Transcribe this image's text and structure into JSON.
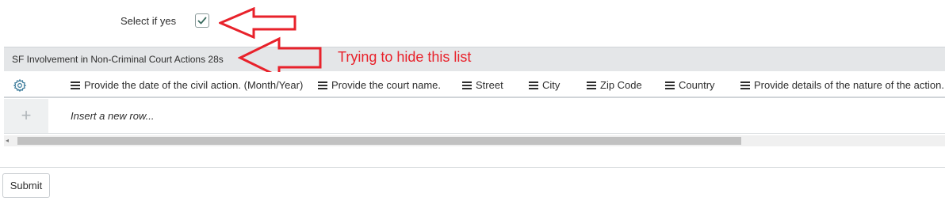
{
  "form": {
    "checkbox_label": "Select if yes",
    "checkbox_checked": true
  },
  "list": {
    "title": "SF Involvement in Non-Criminal Court Actions 28s",
    "columns": [
      "Provide the date of the civil action. (Month/Year)",
      "Provide the court name.",
      "Street",
      "City",
      "Zip Code",
      "Country",
      "Provide details of the nature of the action."
    ],
    "insert_row_text": "Insert a new row...",
    "plus_symbol": "+",
    "scroll_left_symbol": "◂"
  },
  "actions": {
    "submit_label": "Submit"
  },
  "annotations": {
    "note": "Trying to hide this list",
    "color": "#e8222b"
  }
}
